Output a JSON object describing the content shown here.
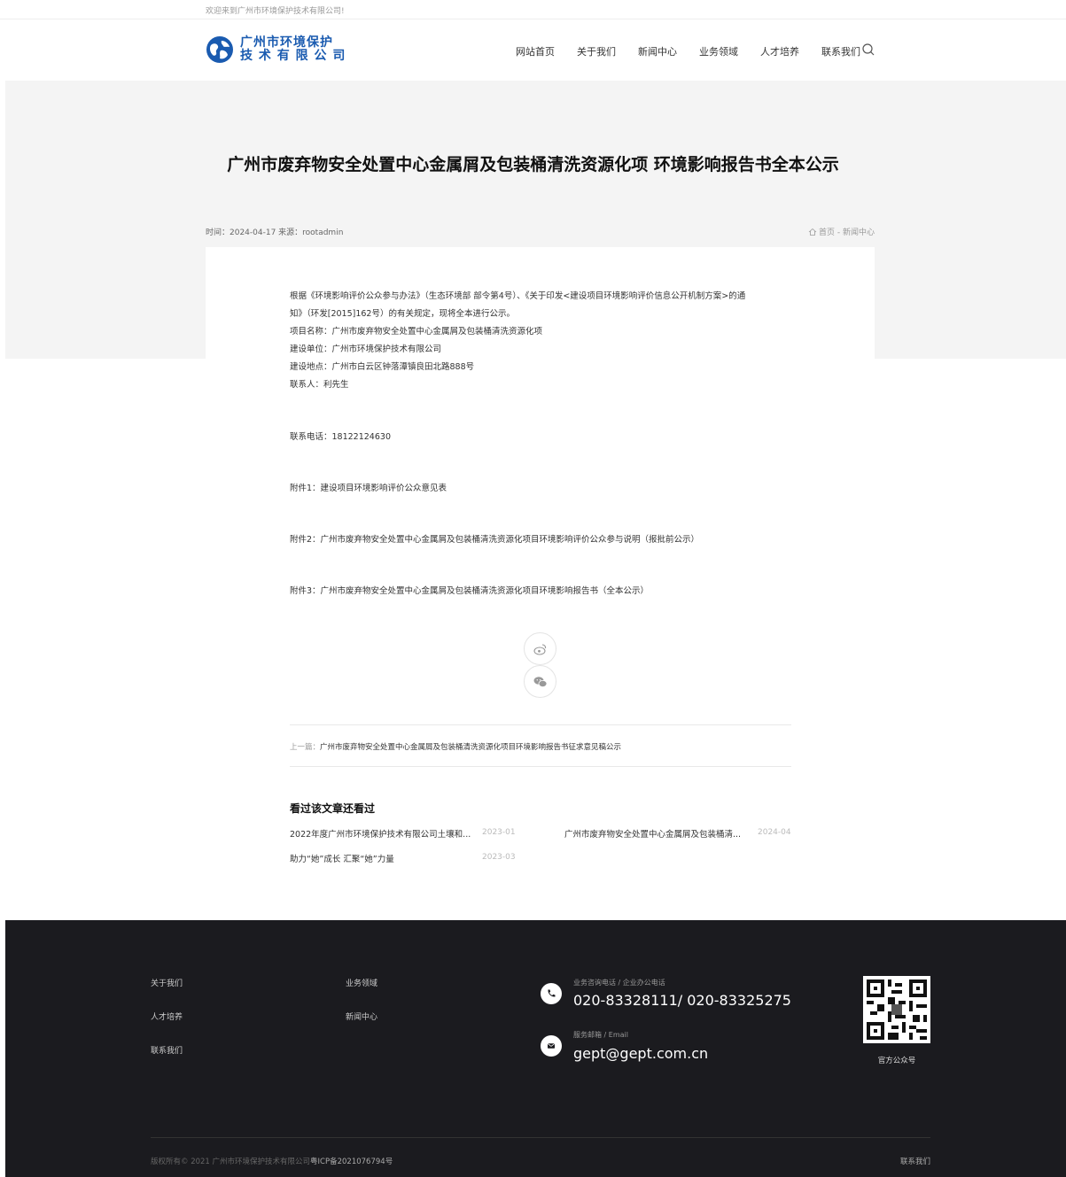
{
  "welcome": "欢迎来到广州市环境保护技术有限公司!",
  "logo": {
    "line1": "广州市环境保护",
    "line2": "技 术 有 限 公 司"
  },
  "nav": [
    "网站首页",
    "关于我们",
    "新闻中心",
    "业务领域",
    "人才培养",
    "联系我们"
  ],
  "article": {
    "title": "广州市废弃物安全处置中心金属屑及包装桶清洗资源化项 环境影响报告书全本公示",
    "meta": "时间：2024-04-17 来源：rootadmin",
    "breadcrumb": "首页 - 新闻中心",
    "intro_lines": [
      "根据《环境影响评价公众参与办法》（生态环境部 部令第4号）、《关于印发<建设项目环境影响评价信息公开机制方案>的通",
      "知》（环发[2015]162号）的有关规定，现将全本进行公示。",
      "项目名称：广州市废弃物安全处置中心金属屑及包装桶清洗资源化项",
      "建设单位：广州市环境保护技术有限公司",
      "建设地点：广州市白云区钟落潭镇良田北路888号",
      "联系人：利先生"
    ],
    "phone": "联系电话：18122124630",
    "attach1": "附件1：建设项目环境影响评价公众意见表",
    "attach2": "附件2：广州市废弃物安全处置中心金属屑及包装桶清洗资源化项目环境影响评价公众参与说明（报批前公示）",
    "attach3": "附件3：广州市废弃物安全处置中心金属屑及包装桶清洗资源化项目环境影响报告书（全本公示）",
    "prev_label": "上一篇：",
    "prev_title": "广州市废弃物安全处置中心金属屑及包装桶清洗资源化项目环境影响报告书征求意见稿公示"
  },
  "related": {
    "title": "看过该文章还看过",
    "items": [
      {
        "title": "2022年度广州市环境保护技术有限公司土壤和...",
        "date": "2023-01"
      },
      {
        "title": "广州市废弃物安全处置中心金属屑及包装桶清...",
        "date": "2024-04"
      },
      {
        "title": "助力“她”成长 汇聚“她”力量",
        "date": "2023-03"
      }
    ]
  },
  "footer": {
    "links_col1": [
      "关于我们",
      "人才培养",
      "联系我们"
    ],
    "links_col2": [
      "业务领域",
      "新闻中心"
    ],
    "phone_label": "业务咨询电话 / 企业办公电话",
    "phone": "020-83328111/ 020-83325275",
    "email_label": "服务邮箱 / Email",
    "email": "gept@gept.com.cn",
    "qr_caption": "官方公众号",
    "copyright": "版权所有© 2021 广州市环境保护技术有限公司",
    "icp": "粤ICP备2021076794号",
    "contact": "联系我们"
  },
  "colors": {
    "brand": "#1a5bb0",
    "footer_bg": "#1b1b1f",
    "hero_bg": "#f4f4f4"
  }
}
